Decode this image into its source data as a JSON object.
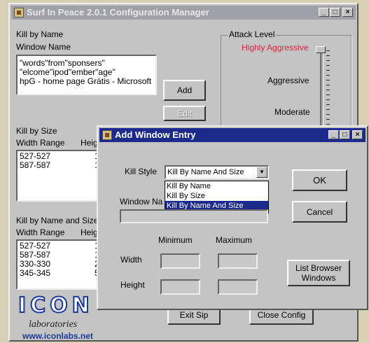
{
  "main_window": {
    "title": "Surf In Peace 2.0.1  Configuration Manager",
    "kill_by_name": {
      "heading": "Kill by Name",
      "subheading": "Window Name",
      "items": [
        "\"words\"from\"sponsers\"",
        "\"elcome\"ipod\"ember\"age\"",
        "hpG - home page Grátis - Microsoft"
      ],
      "add_label": "Add",
      "edit_label": "Edit"
    },
    "attack_level": {
      "heading": "Attack Level",
      "levels": [
        "Highly Aggressive",
        "Aggressive",
        "Moderate"
      ],
      "selected": "Highly Aggressive",
      "selected_color": "#e0203a"
    },
    "kill_by_size": {
      "heading": "Kill by Size",
      "col_width": "Width Range",
      "col_height": "Heig",
      "rows": [
        {
          "width": "527-527",
          "height": "1"
        },
        {
          "width": "587-587",
          "height": "1"
        }
      ]
    },
    "kill_by_name_and_size": {
      "heading": "Kill by Name and Size",
      "col_width": "Width Range",
      "col_height": "Heig",
      "rows": [
        {
          "width": "527-527",
          "height": "1"
        },
        {
          "width": "587-587",
          "height": "1"
        },
        {
          "width": "330-330",
          "height": "2"
        },
        {
          "width": "345-345",
          "height": "5"
        }
      ]
    },
    "exit_label": "Exit Sip",
    "close_label": "Close Config",
    "logo": {
      "brand": "ICON",
      "subtitle": "laboratories",
      "url": "www.iconlabs.net"
    }
  },
  "dialog": {
    "title": "Add Window Entry",
    "kill_style_label": "Kill Style",
    "kill_style_value": "Kill By Name And Size",
    "kill_style_options": [
      "Kill By Name",
      "Kill By Size",
      "Kill By Name And Size"
    ],
    "window_name_label": "Window Na",
    "minimum_label": "Minimum",
    "maximum_label": "Maximum",
    "width_label": "Width",
    "height_label": "Height",
    "ok_label": "OK",
    "cancel_label": "Cancel",
    "list_browser_label": "List Browser Windows"
  },
  "colors": {
    "active_title": "#1c2a8c",
    "inactive_title": "#a0a0a8",
    "selection": "#1c2a8c",
    "logo_blue": "#1a3a9a"
  }
}
